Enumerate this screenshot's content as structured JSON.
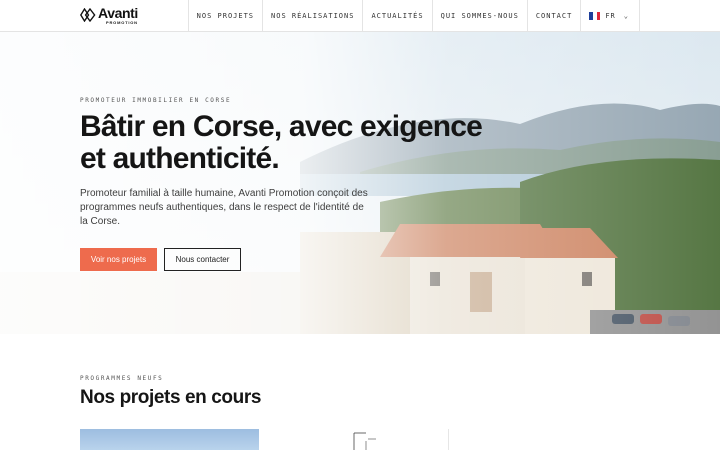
{
  "header": {
    "logo": {
      "name": "Avanti",
      "subtitle": "PROMOTION"
    },
    "nav": [
      {
        "label": "NOS PROJETS"
      },
      {
        "label": "NOS RÉALISATIONS"
      },
      {
        "label": "ACTUALITÉS"
      },
      {
        "label": "QUI SOMMES-NOUS"
      },
      {
        "label": "CONTACT"
      }
    ],
    "language": {
      "label": "FR",
      "flag_colors": [
        "#1f3f9a",
        "#ffffff",
        "#e0283a"
      ]
    }
  },
  "hero": {
    "eyebrow": "PROMOTEUR IMMOBILIER EN CORSE",
    "title": "Bâtir en Corse, avec exigence et authenticité.",
    "description": "Promoteur familial à taille humaine, Avanti Promotion conçoit des programmes neufs authentiques, dans le respect de l'identité de la Corse.",
    "primary_button": "Voir nos projets",
    "secondary_button": "Nous contacter"
  },
  "projects": {
    "eyebrow": "PROGRAMMES NEUFS",
    "title": "Nos projets en cours"
  },
  "colors": {
    "accent": "#ee6b4d",
    "text": "#151515"
  }
}
